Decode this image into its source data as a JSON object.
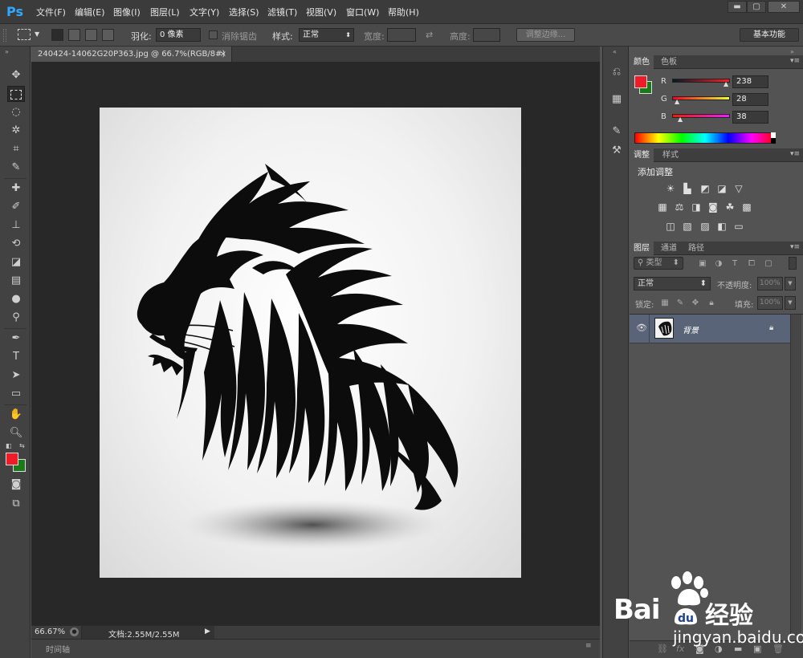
{
  "app": {
    "logo": "Ps"
  },
  "menu": [
    "文件(F)",
    "编辑(E)",
    "图像(I)",
    "图层(L)",
    "文字(Y)",
    "选择(S)",
    "滤镜(T)",
    "视图(V)",
    "窗口(W)",
    "帮助(H)"
  ],
  "window_controls": {
    "minimize": "▬",
    "maximize": "▢",
    "close": "✕"
  },
  "options": {
    "feather_label": "羽化:",
    "feather_value": "0 像素",
    "antialias_label": "消除锯齿",
    "style_label": "样式:",
    "style_value": "正常",
    "width_label": "宽度:",
    "height_label": "高度:",
    "refine_edge": "调整边缘...",
    "workspace": "基本功能"
  },
  "document": {
    "tab_title": "240424-14062G20P363.jpg @ 66.7%(RGB/8#)",
    "tab_close": "×",
    "zoom": "66.67%",
    "doc_info": "文档:2.55M/2.55M",
    "timeline_label": "时间轴"
  },
  "color_panel": {
    "tabs": [
      "颜色",
      "色板"
    ],
    "r_label": "R",
    "g_label": "G",
    "b_label": "B",
    "r": "238",
    "g": "28",
    "b": "38",
    "foreground": "#ee1c26",
    "background": "#1a7a1a"
  },
  "adjust_panel": {
    "tabs": [
      "调整",
      "样式"
    ],
    "heading": "添加调整"
  },
  "layers_panel": {
    "tabs": [
      "图层",
      "通道",
      "路径"
    ],
    "filter_kind": "类型",
    "blend_mode": "正常",
    "opacity_label": "不透明度:",
    "opacity_value": "100%",
    "lock_label": "锁定:",
    "fill_label": "填充:",
    "fill_value": "100%",
    "layers": [
      {
        "name": "背景",
        "visible": true,
        "locked": true
      }
    ]
  },
  "toolbox_colors": {
    "foreground": "#ee1c26",
    "background": "#1a7a1a"
  },
  "watermark": {
    "brand_prefix": "Bai",
    "brand_suffix": "经验",
    "url": "jingyan.baidu.com"
  }
}
